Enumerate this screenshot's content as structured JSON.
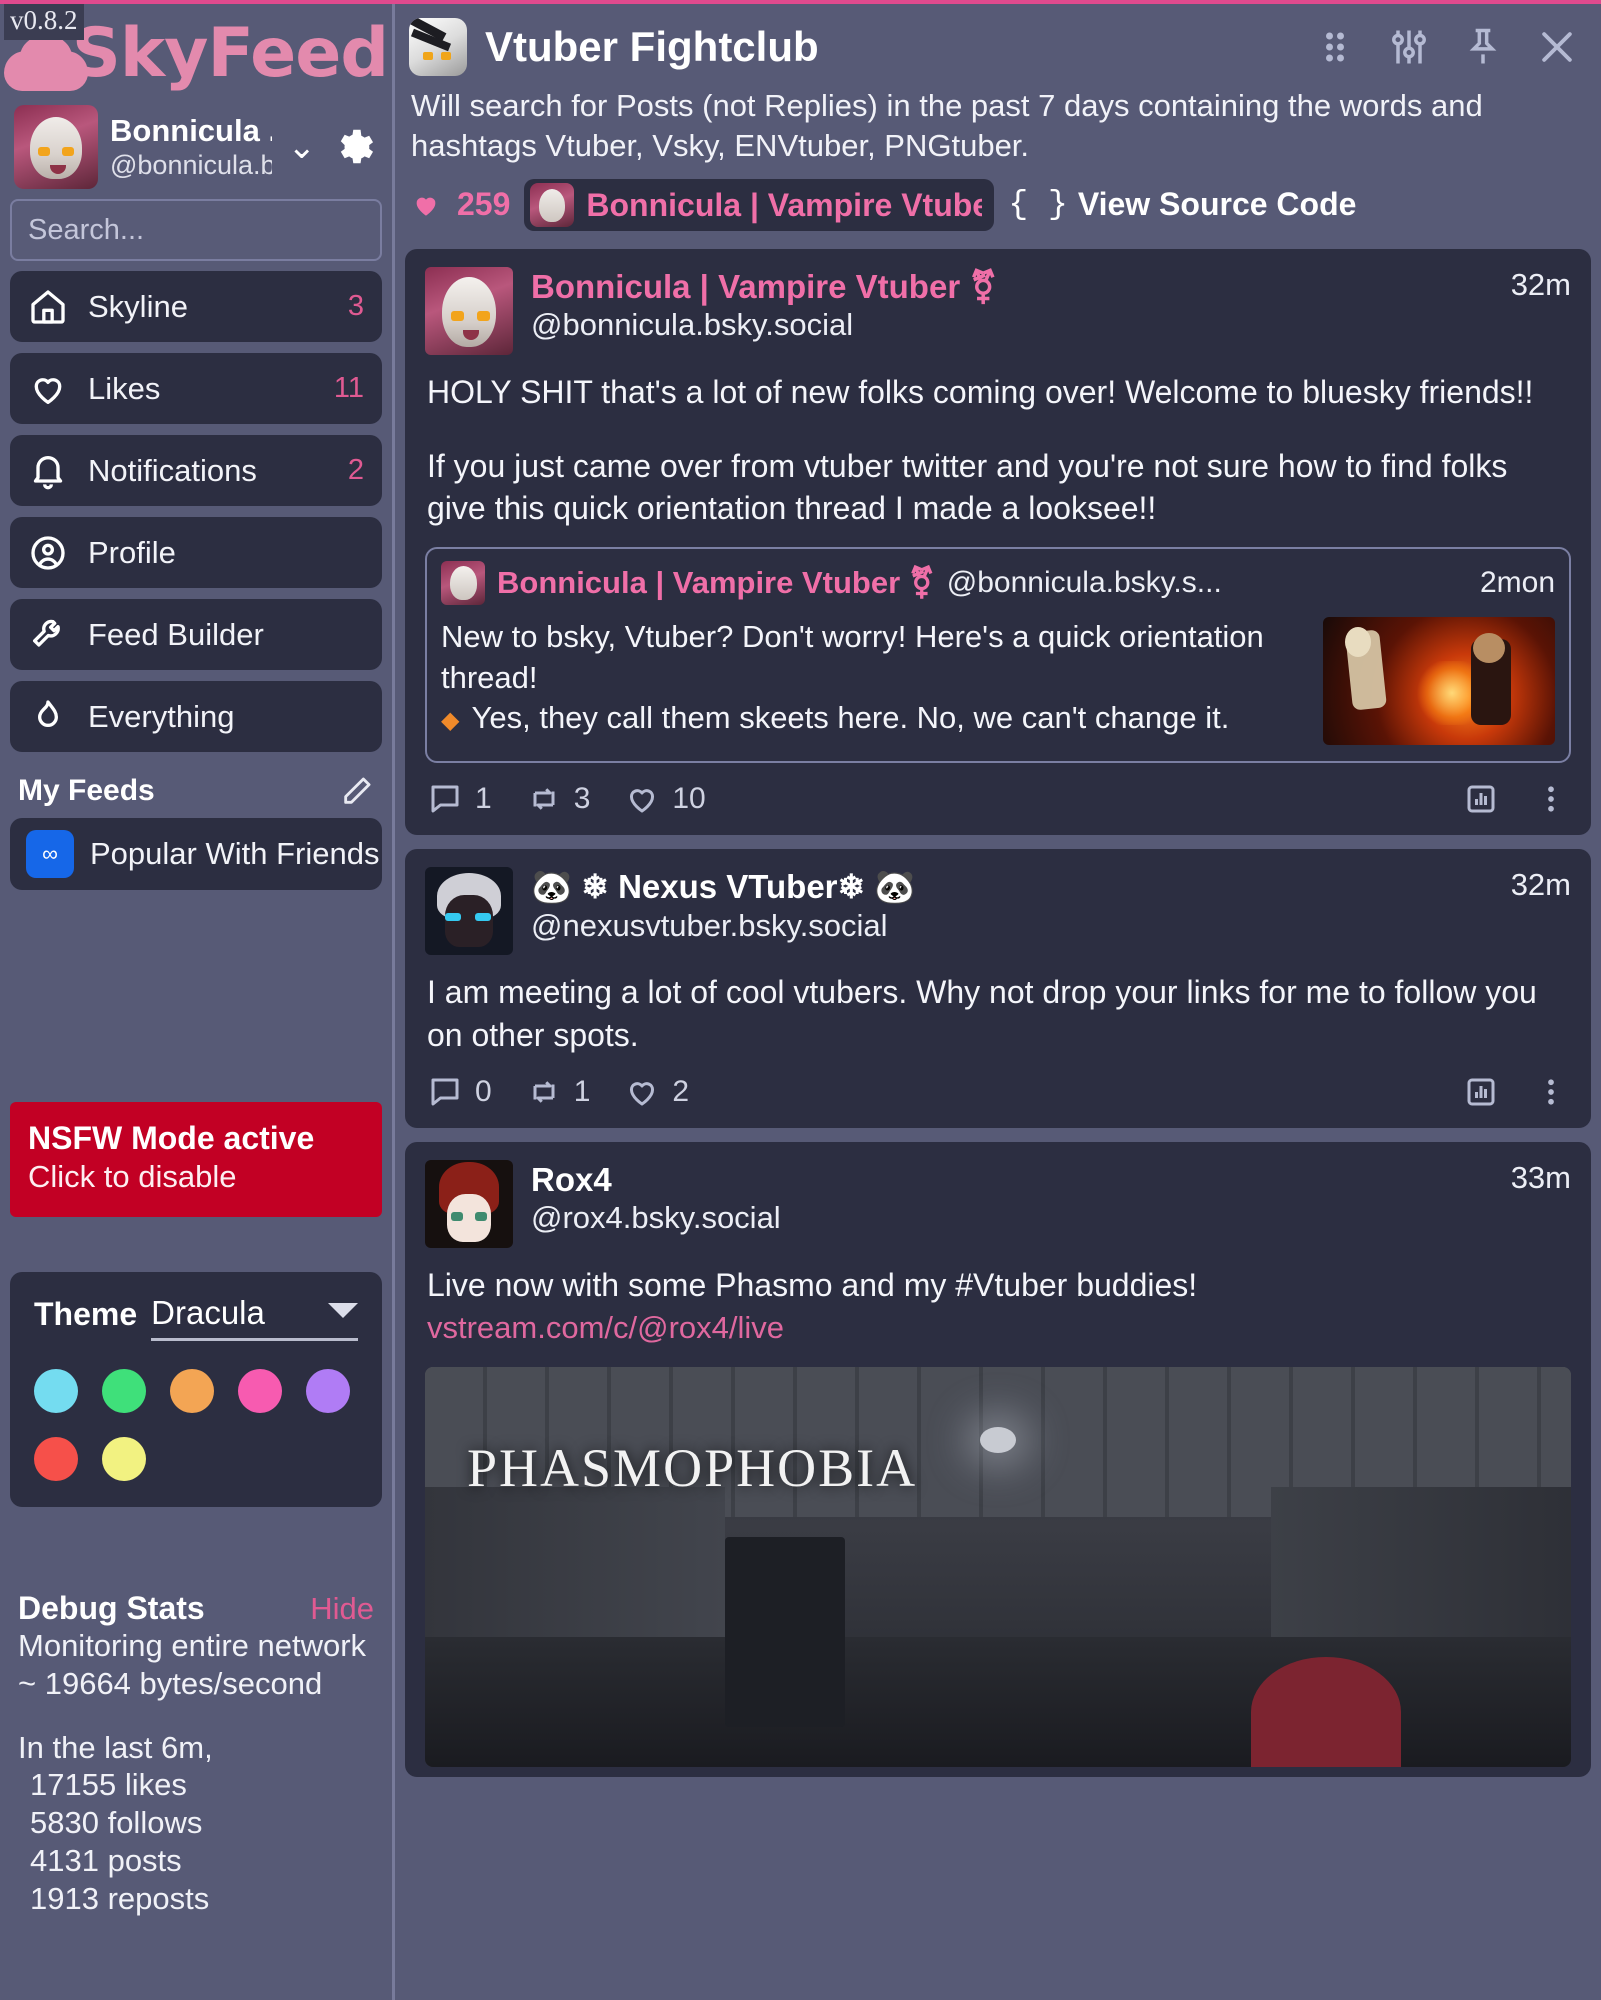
{
  "app": {
    "version": "v0.8.2",
    "brand": "SkyFeed"
  },
  "account": {
    "display_name": "Bonnicula ...",
    "handle": "@bonnicula.b...",
    "chevron_icon": "chevron-down-icon",
    "settings_icon": "gear-icon"
  },
  "search": {
    "placeholder": "Search..."
  },
  "nav": {
    "items": [
      {
        "label": "Skyline",
        "count": "3",
        "icon": "home-icon"
      },
      {
        "label": "Likes",
        "count": "11",
        "icon": "heart-icon"
      },
      {
        "label": "Notifications",
        "count": "2",
        "icon": "bell-icon"
      },
      {
        "label": "Profile",
        "count": "",
        "icon": "user-circle-icon"
      },
      {
        "label": "Feed Builder",
        "count": "",
        "icon": "wrench-icon"
      },
      {
        "label": "Everything",
        "count": "",
        "icon": "flame-icon"
      }
    ]
  },
  "my_feeds": {
    "title": "My Feeds",
    "edit_icon": "pencil-icon",
    "items": [
      {
        "label": "Popular With Friends",
        "icon_glyph": "∞"
      }
    ]
  },
  "nsfw": {
    "title": "NSFW Mode active",
    "subtitle": "Click to disable",
    "color": "#c20024"
  },
  "theme": {
    "label": "Theme",
    "value": "Dracula",
    "caret_icon": "chevron-down-icon",
    "swatches": [
      "#74dcf0",
      "#3fe07a",
      "#f3a košice"
    ]
  },
  "theme_colors": [
    "#74dcf0",
    "#3fe07a",
    "#f3a554",
    "#f75bb0",
    "#b07cf5",
    "#f6504a",
    "#f2f281"
  ],
  "debug": {
    "title": "Debug Stats",
    "hide_label": "Hide",
    "line1": "Monitoring entire network",
    "line2": "~ 19664 bytes/second",
    "line3": "In the last 6m,",
    "stats": [
      "17155 likes",
      "5830 follows",
      "4131 posts",
      "1913 reposts"
    ]
  },
  "column": {
    "icon": "column-avatar-icon",
    "title": "Vtuber Fightclub",
    "description": "Will search for Posts (not Replies) in the past 7 days containing the words and hashtags Vtuber, Vsky, ENVtuber, PNGtuber.",
    "head_icons": [
      {
        "name": "drag-handle-icon"
      },
      {
        "name": "sliders-icon"
      },
      {
        "name": "pin-icon"
      },
      {
        "name": "close-icon"
      }
    ],
    "likes": "259",
    "author": "Bonnicula | Vampire Vtuber ⚧...",
    "source_braces": "{ }",
    "source_label": "View Source Code",
    "accent_pink": "#f06fa8"
  },
  "posts": [
    {
      "avatar": "bonnicula",
      "display_name": "Bonnicula | Vampire Vtuber ⚧",
      "handle": "@bonnicula.bsky.social",
      "time": "32m",
      "body_1": "HOLY SHIT that's a lot of new folks coming over! Welcome to bluesky friends!!",
      "body_2": "If you just came over from vtuber twitter and you're not sure how to find folks give this quick orientation thread I made a looksee!!",
      "quote": {
        "display_name": "Bonnicula | Vampire Vtuber ⚧",
        "handle": "@bonnicula.bsky.s...",
        "time": "2mon",
        "text_1": "New to bsky, Vtuber? Don't worry! Here's a quick orientation thread!",
        "text_2": "Yes, they call them skeets here. No, we can't change it.",
        "bullet": "◆",
        "has_thumbnail": true
      },
      "actions": {
        "replies": "1",
        "reposts": "3",
        "likes": "10"
      },
      "chart_icon": "bar-chart-icon",
      "more_icon": "more-vertical-icon"
    },
    {
      "avatar": "nexus",
      "display_name": "🐼 ❄ Nexus VTuber❄ 🐼",
      "handle": "@nexusvtuber.bsky.social",
      "time": "32m",
      "body_1": "I am meeting a lot of cool vtubers. Why not drop your links for me to follow you on other spots.",
      "actions": {
        "replies": "0",
        "reposts": "1",
        "likes": "2"
      },
      "chart_icon": "bar-chart-icon",
      "more_icon": "more-vertical-icon"
    },
    {
      "avatar": "rox",
      "display_name": "Rox4",
      "handle": "@rox4.bsky.social",
      "time": "33m",
      "body_1": "Live now with some Phasmo and my #Vtuber buddies!",
      "link": "vstream.com/c/@rox4/live",
      "image_caption": "PHASMOPHOBIA"
    }
  ]
}
